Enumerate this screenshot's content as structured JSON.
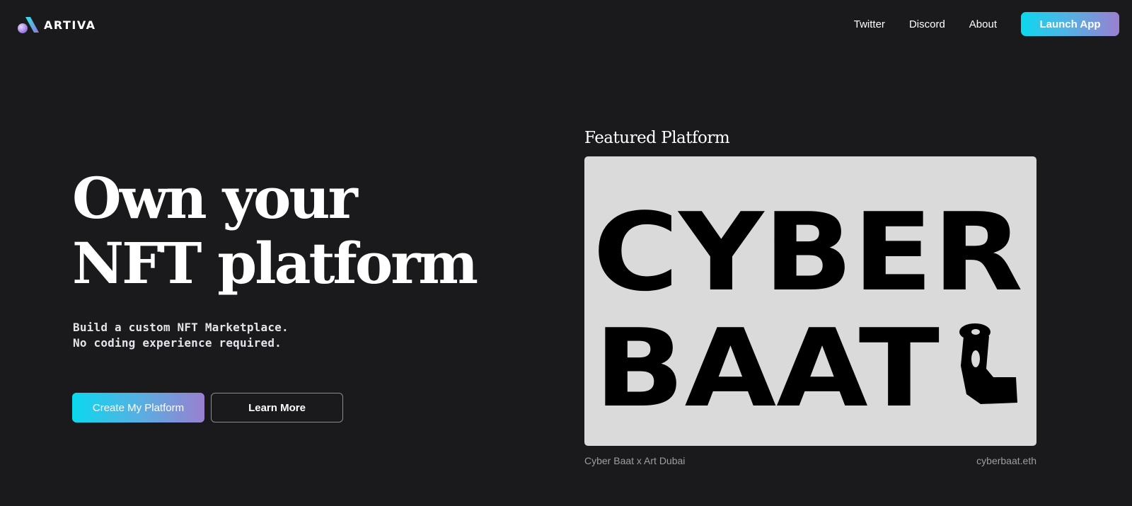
{
  "header": {
    "brand": "ARTIVA",
    "nav": [
      {
        "label": "Twitter"
      },
      {
        "label": "Discord"
      },
      {
        "label": "About"
      }
    ],
    "launch_label": "Launch App"
  },
  "hero": {
    "title_line1": "Own your",
    "title_line2": "NFT platform",
    "subtitle_line1": "Build a custom NFT Marketplace.",
    "subtitle_line2": "No coding experience required.",
    "primary_cta": "Create My Platform",
    "secondary_cta": "Learn More"
  },
  "featured": {
    "heading": "Featured Platform",
    "artwork_text_line1": "CYBER",
    "artwork_text_line2": "BAAT",
    "caption": "Cyber Baat x Art Dubai",
    "ens": "cyberbaat.eth"
  },
  "colors": {
    "background": "#1a1a1c",
    "gradient_start": "#0cd8ee",
    "gradient_end": "#9a7fd0",
    "card_background": "#dadada",
    "muted_text": "#9d9da3"
  },
  "icons": {
    "brand_logo": "artiva-logo-icon",
    "artwork_figure": "hand-figure-icon"
  }
}
